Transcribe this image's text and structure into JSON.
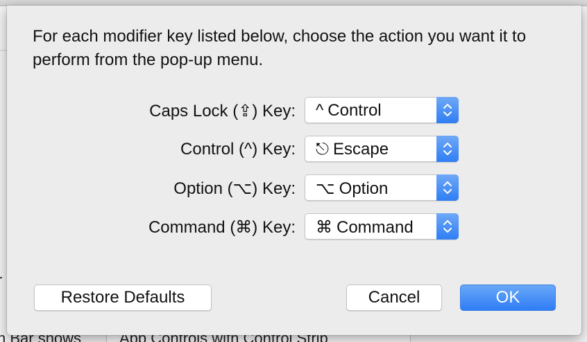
{
  "background": {
    "fragments": [
      "j",
      "r",
      "n Bar shows",
      "App Controls with Control Strip"
    ],
    "popup_chevron": "⌄"
  },
  "dialog": {
    "intro": "For each modifier key listed below, choose the action you want it to perform from the pop-up menu.",
    "rows": [
      {
        "label": "Caps Lock (⇪) Key:",
        "value_glyph": "^",
        "value_text": "Control"
      },
      {
        "label": "Control (^) Key:",
        "value_glyph": "⎋",
        "value_text": "Escape"
      },
      {
        "label": "Option (⌥) Key:",
        "value_glyph": "⌥",
        "value_text": "Option"
      },
      {
        "label": "Command (⌘) Key:",
        "value_glyph": "⌘",
        "value_text": "Command"
      }
    ],
    "buttons": {
      "restore": "Restore Defaults",
      "cancel": "Cancel",
      "ok": "OK"
    }
  },
  "colors": {
    "accent": "#2f7ef3",
    "dialog_bg": "#ececec"
  }
}
